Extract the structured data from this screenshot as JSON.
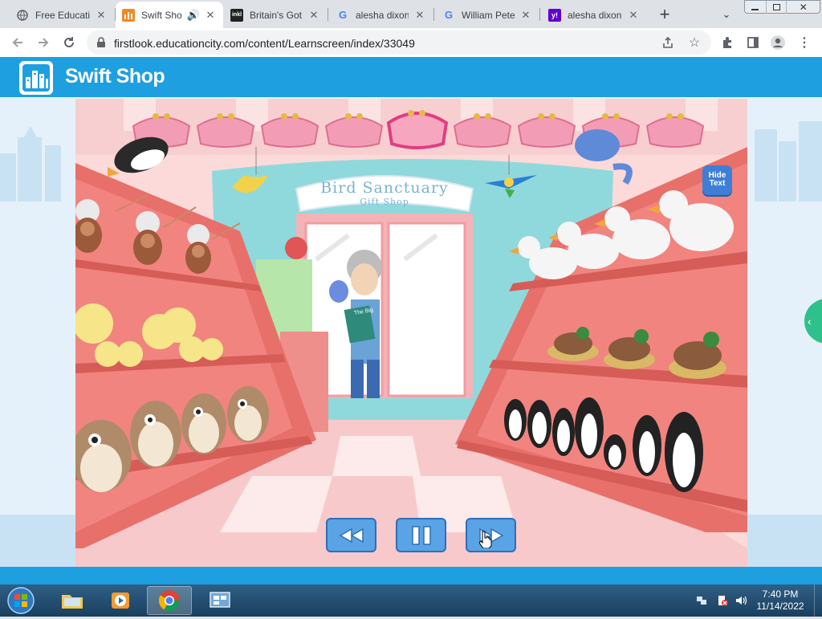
{
  "browser": {
    "tabs": [
      {
        "label": "Free Educatio",
        "icon": "globe-icon"
      },
      {
        "label": "Swift Sho",
        "icon": "educationcity-icon",
        "active": true
      },
      {
        "label": "Britain's Got",
        "icon": "inkl-icon",
        "icon_text": "inkl"
      },
      {
        "label": "alesha dixon",
        "icon": "google-icon",
        "icon_text": "G"
      },
      {
        "label": "William Pete",
        "icon": "google-icon",
        "icon_text": "G"
      },
      {
        "label": "alesha dixon",
        "icon": "yahoo-icon",
        "icon_text": "y!"
      }
    ],
    "new_tab_symbol": "+",
    "url": "firstlook.educationcity.com/content/Learnscreen/index/33049"
  },
  "site": {
    "title": "Swift Shop"
  },
  "game": {
    "sign_title": "Bird Sanctuary",
    "sign_subtitle": "Gift Shop",
    "book_text": "The Big",
    "hide_text_label": "Hide Text",
    "controls": [
      "rewind",
      "pause",
      "forward"
    ]
  },
  "taskbar": {
    "time": "7:40 PM",
    "date": "11/14/2022"
  },
  "colors": {
    "header_blue": "#1d9fe0",
    "shelf_red": "#e8706a",
    "canvas_pink": "#fbdad9",
    "button_blue": "#5aa3e5"
  }
}
